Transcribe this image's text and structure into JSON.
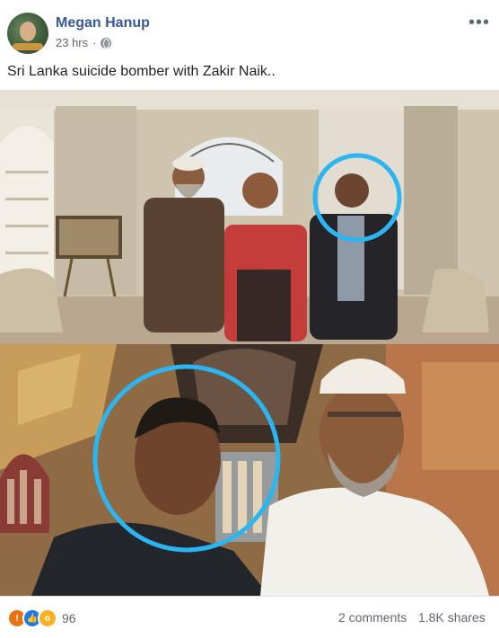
{
  "post": {
    "author": "Megan Hanup",
    "time": "23 hrs",
    "separator": "·",
    "caption": "Sri Lanka suicide bomber with Zakir Naik..",
    "more": "•••"
  },
  "photos": [
    {
      "name": "photo-top",
      "description_icon": "palace-room-photo"
    },
    {
      "name": "photo-bottom",
      "description_icon": "church-interior-photo"
    }
  ],
  "highlight_color": "#2bb6f2",
  "footer": {
    "reaction_count": "96",
    "comments": "2 comments",
    "shares": "1.8K shares"
  }
}
